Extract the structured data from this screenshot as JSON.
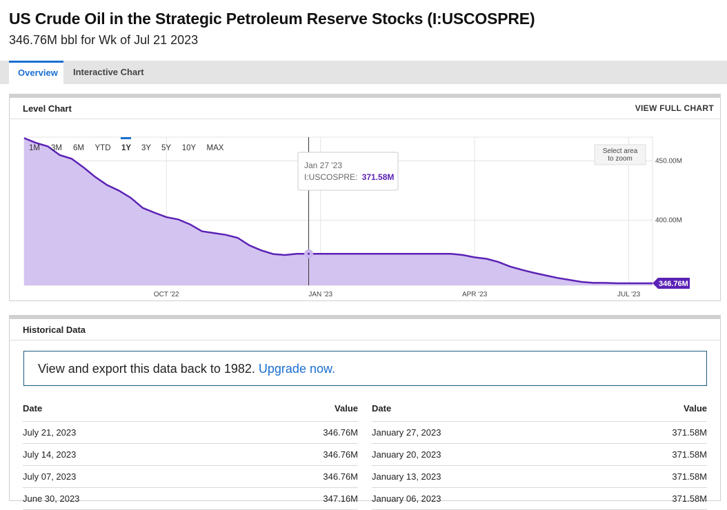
{
  "header": {
    "title": "US Crude Oil in the Strategic Petroleum Reserve Stocks (I:USCOSPRE)",
    "subtitle": "346.76M bbl for Wk of Jul 21 2023"
  },
  "tabs": [
    {
      "label": "Overview",
      "active": true
    },
    {
      "label": "Interactive Chart",
      "active": false
    }
  ],
  "level_chart": {
    "heading": "Level Chart",
    "full_chart_link": "VIEW FULL CHART",
    "zoom_buttons": [
      "1M",
      "3M",
      "6M",
      "YTD",
      "1Y",
      "3Y",
      "5Y",
      "10Y",
      "MAX"
    ],
    "active_zoom": "1Y",
    "select_zoom_hint": [
      "Select area",
      "to zoom"
    ],
    "tooltip": {
      "date": "Jan 27 '23",
      "series": "I:USCOSPRE:",
      "value": "371.58M"
    },
    "last_value_label": "346.76M",
    "accent_color": "#5b22b5",
    "fill_color": "#d3c3f0"
  },
  "chart_data": {
    "type": "area",
    "x_unit": "weeks from Jul 2022",
    "x_ticks": [
      {
        "label": "OCT '22",
        "x": 12
      },
      {
        "label": "JAN '23",
        "x": 25
      },
      {
        "label": "APR '23",
        "x": 38
      },
      {
        "label": "JUL '23",
        "x": 51
      }
    ],
    "y_ticks": [
      {
        "label": "450.00M",
        "y": 450
      },
      {
        "label": "400.00M",
        "y": 400
      }
    ],
    "ylim": [
      345.0,
      470.0
    ],
    "x": [
      0,
      1,
      2,
      3,
      4,
      5,
      6,
      7,
      8,
      9,
      10,
      11,
      12,
      13,
      14,
      15,
      16,
      17,
      18,
      19,
      20,
      21,
      22,
      23,
      24,
      25,
      26,
      27,
      28,
      29,
      30,
      31,
      32,
      33,
      34,
      35,
      36,
      37,
      38,
      39,
      40,
      41,
      42,
      43,
      44,
      45,
      46,
      47,
      48,
      49,
      50,
      51,
      52,
      53
    ],
    "values": [
      469.2,
      465.2,
      462.2,
      454.9,
      451.8,
      444.6,
      436.4,
      429.6,
      424.9,
      418.8,
      410.3,
      406.3,
      402.5,
      400.6,
      396.4,
      390.6,
      389.1,
      387.6,
      385.1,
      378.7,
      374.5,
      371.4,
      370.6,
      371.6,
      371.58,
      371.58,
      371.58,
      371.58,
      371.58,
      371.58,
      371.58,
      371.58,
      371.58,
      371.58,
      371.58,
      371.58,
      371.58,
      370.6,
      368.6,
      367.4,
      364.7,
      360.8,
      358.0,
      355.5,
      353.4,
      351.2,
      349.6,
      347.9,
      347.1,
      347.1,
      346.76,
      346.76,
      346.76,
      346.76
    ],
    "title": "",
    "xlabel": "",
    "ylabel": "",
    "grid": true,
    "marker_index": 24
  },
  "historical": {
    "heading": "Historical Data",
    "upgrade_text": "View and export this data back to 1982.",
    "upgrade_link": "Upgrade now.",
    "col_date": "Date",
    "col_value": "Value",
    "left_rows": [
      {
        "date": "July 21, 2023",
        "value": "346.76M"
      },
      {
        "date": "July 14, 2023",
        "value": "346.76M"
      },
      {
        "date": "July 07, 2023",
        "value": "346.76M"
      },
      {
        "date": "June 30, 2023",
        "value": "347.16M"
      }
    ],
    "right_rows": [
      {
        "date": "January 27, 2023",
        "value": "371.58M"
      },
      {
        "date": "January 20, 2023",
        "value": "371.58M"
      },
      {
        "date": "January 13, 2023",
        "value": "371.58M"
      },
      {
        "date": "January 06, 2023",
        "value": "371.58M"
      }
    ]
  }
}
